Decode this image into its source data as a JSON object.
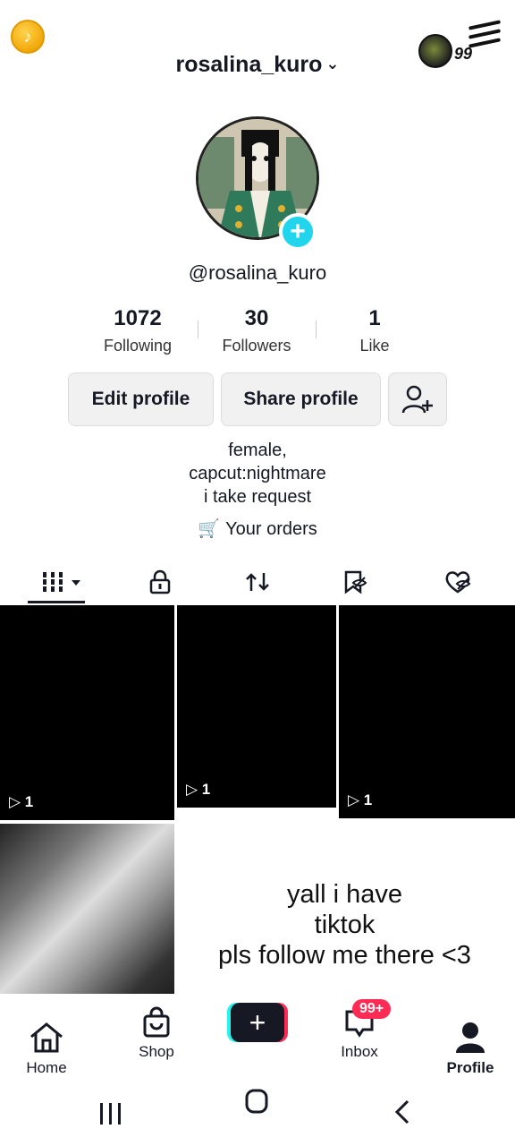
{
  "header": {
    "username": "rosalina_kuro",
    "notification_count": "99"
  },
  "profile": {
    "handle": "@rosalina_kuro",
    "stats": [
      {
        "value": "1072",
        "label": "Following"
      },
      {
        "value": "30",
        "label": "Followers"
      },
      {
        "value": "1",
        "label": "Like"
      }
    ],
    "buttons": {
      "edit": "Edit profile",
      "share": "Share profile"
    },
    "bio": [
      "female,",
      "capcut:nightmare",
      "i take request"
    ],
    "orders_label": "Your orders"
  },
  "videos": [
    {
      "views": "1"
    },
    {
      "views": "1"
    },
    {
      "views": "1"
    }
  ],
  "caption_post": [
    "yall i have",
    "tiktok",
    "pls follow me there  <3"
  ],
  "bottom_nav": {
    "home": "Home",
    "shop": "Shop",
    "inbox": "Inbox",
    "inbox_badge": "99+",
    "profile": "Profile"
  },
  "colors": {
    "accent_red": "#fe2c55",
    "accent_cyan": "#20d5ec"
  }
}
